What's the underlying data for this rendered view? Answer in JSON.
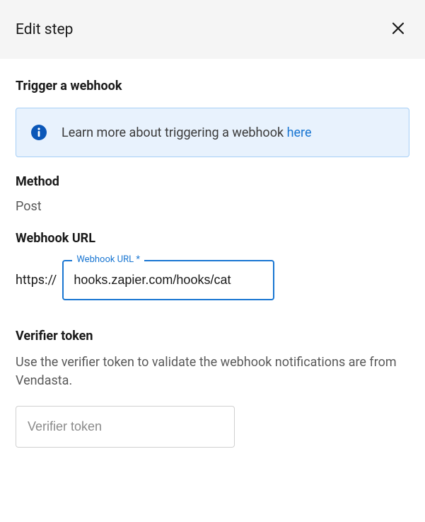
{
  "header": {
    "title": "Edit step"
  },
  "main": {
    "heading": "Trigger a webhook",
    "info": {
      "text_prefix": "Learn more about triggering a webhook ",
      "link_text": "here"
    },
    "method": {
      "label": "Method",
      "value": "Post"
    },
    "webhook_url": {
      "label": "Webhook URL",
      "prefix": "https://",
      "floating_label": "Webhook URL *",
      "value": "hooks.zapier.com/hooks/cat"
    },
    "verifier": {
      "label": "Verifier token",
      "description": "Use the verifier token to validate the webhook notifications are from Vendasta.",
      "placeholder": "Verifier token",
      "value": ""
    }
  }
}
